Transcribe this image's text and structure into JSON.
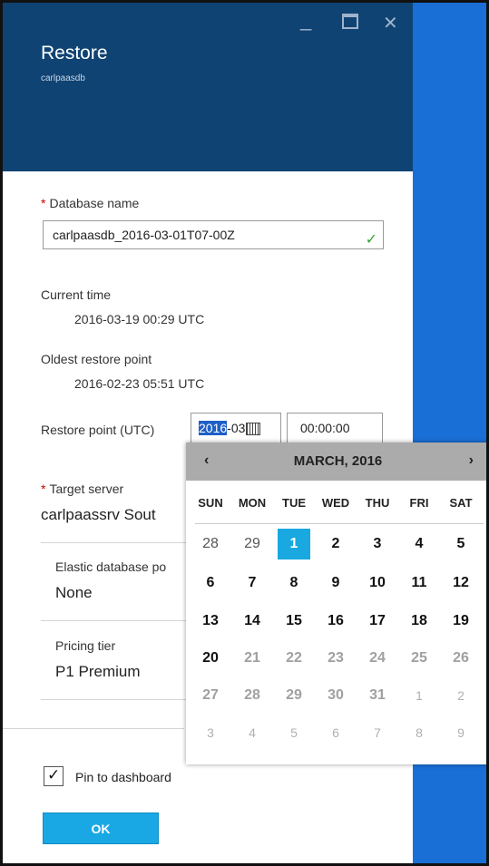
{
  "window": {
    "title": "Restore",
    "subtitle": "carlpaasdb",
    "controls": {
      "minimize": "_",
      "close": "✕"
    }
  },
  "form": {
    "database_name": {
      "label": "Database name",
      "value": "carlpaasdb_2016-03-01T07-00Z",
      "valid_mark": "✓"
    },
    "current_time": {
      "label": "Current time",
      "value": "2016-03-19 00:29 UTC"
    },
    "oldest_restore_point": {
      "label": "Oldest restore point",
      "value": "2016-02-23 05:51 UTC"
    },
    "restore_point": {
      "label": "Restore point (UTC)",
      "date_year": "2016",
      "date_rest": "-03",
      "time": "00:00:00"
    },
    "target_server": {
      "label": "Target server",
      "value": "carlpaassrv Sout"
    },
    "elastic_pool": {
      "label": "Elastic database po",
      "value": "None"
    },
    "pricing_tier": {
      "label": "Pricing tier",
      "value": "P1 Premium"
    },
    "required_mark": "*"
  },
  "calendar": {
    "month_label": "MARCH, 2016",
    "prev": "‹",
    "next": "›",
    "weekdays": [
      "SUN",
      "MON",
      "TUE",
      "WED",
      "THU",
      "FRI",
      "SAT"
    ],
    "weeks": [
      [
        {
          "d": "28",
          "s": "muted"
        },
        {
          "d": "29",
          "s": "muted"
        },
        {
          "d": "1",
          "s": "sel"
        },
        {
          "d": "2",
          "s": "bold"
        },
        {
          "d": "3",
          "s": "bold"
        },
        {
          "d": "4",
          "s": "bold"
        },
        {
          "d": "5",
          "s": "bold"
        }
      ],
      [
        {
          "d": "6",
          "s": "bold"
        },
        {
          "d": "7",
          "s": "bold"
        },
        {
          "d": "8",
          "s": "bold"
        },
        {
          "d": "9",
          "s": "bold"
        },
        {
          "d": "10",
          "s": "bold"
        },
        {
          "d": "11",
          "s": "bold"
        },
        {
          "d": "12",
          "s": "bold"
        }
      ],
      [
        {
          "d": "13",
          "s": "bold"
        },
        {
          "d": "14",
          "s": "bold"
        },
        {
          "d": "15",
          "s": "bold"
        },
        {
          "d": "16",
          "s": "bold"
        },
        {
          "d": "17",
          "s": "bold"
        },
        {
          "d": "18",
          "s": "bold"
        },
        {
          "d": "19",
          "s": "bold"
        }
      ],
      [
        {
          "d": "20",
          "s": "bold"
        },
        {
          "d": "21",
          "s": "grey"
        },
        {
          "d": "22",
          "s": "grey"
        },
        {
          "d": "23",
          "s": "grey"
        },
        {
          "d": "24",
          "s": "grey"
        },
        {
          "d": "25",
          "s": "grey"
        },
        {
          "d": "26",
          "s": "grey"
        }
      ],
      [
        {
          "d": "27",
          "s": "grey"
        },
        {
          "d": "28",
          "s": "grey"
        },
        {
          "d": "29",
          "s": "grey"
        },
        {
          "d": "30",
          "s": "grey"
        },
        {
          "d": "31",
          "s": "grey"
        },
        {
          "d": "1",
          "s": "faint"
        },
        {
          "d": "2",
          "s": "faint"
        }
      ],
      [
        {
          "d": "3",
          "s": "faint"
        },
        {
          "d": "4",
          "s": "faint"
        },
        {
          "d": "5",
          "s": "faint"
        },
        {
          "d": "6",
          "s": "faint"
        },
        {
          "d": "7",
          "s": "faint"
        },
        {
          "d": "8",
          "s": "faint"
        },
        {
          "d": "9",
          "s": "faint"
        }
      ]
    ],
    "selected_day": "1"
  },
  "footer": {
    "pin_label": "Pin to dashboard",
    "pin_checked": true,
    "pin_mark": "✓",
    "ok_label": "OK"
  },
  "colors": {
    "header_bg": "#0f4373",
    "side_blue": "#1a6fd6",
    "accent": "#19a8e0",
    "required": "#cc0000"
  }
}
